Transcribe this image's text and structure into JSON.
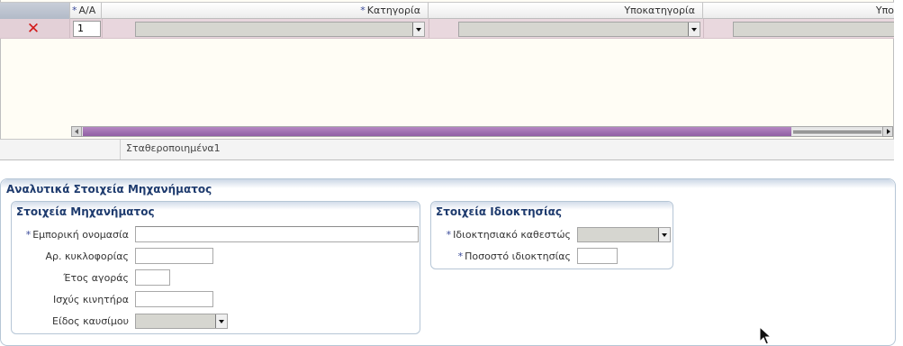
{
  "table": {
    "columns": [
      {
        "label": "A/A",
        "required": true
      },
      {
        "label": "Κατηγορία",
        "required": true
      },
      {
        "label": "Υποκατηγορία",
        "required": false
      },
      {
        "label": "Υπο",
        "required": false
      }
    ],
    "required_marker": "*",
    "rows": [
      {
        "aa": "1",
        "category": "",
        "subcategory": "",
        "subsub": ""
      }
    ],
    "footer_text": "Σταθεροποιημένα1"
  },
  "detail": {
    "title": "Αναλυτικά Στοιχεία Μηχανήματος",
    "machine": {
      "title": "Στοιχεία Μηχανήματος",
      "fields": [
        {
          "label": "Εμπορική ονομασία",
          "required": true,
          "value": ""
        },
        {
          "label": "Αρ. κυκλοφορίας",
          "required": false,
          "value": ""
        },
        {
          "label": "Έτος αγοράς",
          "required": false,
          "value": ""
        },
        {
          "label": "Ισχύς κινητήρα",
          "required": false,
          "value": ""
        },
        {
          "label": "Είδος καυσίμου",
          "required": false,
          "value": ""
        }
      ]
    },
    "ownership": {
      "title": "Στοιχεία Ιδιοκτησίας",
      "fields": [
        {
          "label": "Ιδιοκτησιακό καθεστώς",
          "required": true,
          "value": ""
        },
        {
          "label": "Ποσοστό ιδιοκτησίας",
          "required": true,
          "value": ""
        }
      ]
    }
  },
  "icons": {
    "delete": "delete-x-icon",
    "dropdown": "chevron-down-icon",
    "scroll_left": "arrow-left-icon",
    "scroll_right": "arrow-right-icon",
    "cursor": "mouse-pointer-icon"
  },
  "colors": {
    "row_highlight": "#e6d3da",
    "scroll_thumb": "#9b6aad",
    "section_title": "#1e3b6e",
    "delete_icon": "#d21818",
    "required_marker": "#3a4a9a"
  }
}
